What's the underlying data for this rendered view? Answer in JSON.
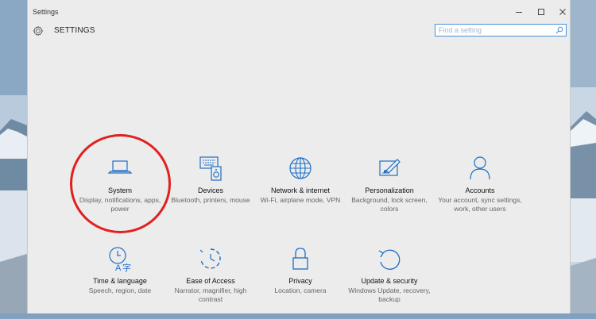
{
  "window": {
    "title": "Settings",
    "minimize_label": "Minimize",
    "maximize_label": "Maximize",
    "close_label": "Close"
  },
  "header": {
    "title": "SETTINGS"
  },
  "search": {
    "placeholder": "Find a setting",
    "value": ""
  },
  "categories": [
    {
      "label": "System",
      "description": "Display, notifications, apps, power",
      "icon": "laptop-icon"
    },
    {
      "label": "Devices",
      "description": "Bluetooth, printers, mouse",
      "icon": "keyboard-speaker-icon"
    },
    {
      "label": "Network & internet",
      "description": "Wi-Fi, airplane mode, VPN",
      "icon": "globe-icon"
    },
    {
      "label": "Personalization",
      "description": "Background, lock screen, colors",
      "icon": "paint-brush-icon"
    },
    {
      "label": "Accounts",
      "description": "Your account, sync settings, work, other users",
      "icon": "person-icon"
    },
    {
      "label": "Time & language",
      "description": "Speech, region, date",
      "icon": "clock-language-icon"
    },
    {
      "label": "Ease of Access",
      "description": "Narrator, magnifier, high contrast",
      "icon": "stopwatch-icon"
    },
    {
      "label": "Privacy",
      "description": "Location, camera",
      "icon": "lock-icon"
    },
    {
      "label": "Update & security",
      "description": "Windows Update, recovery, backup",
      "icon": "refresh-icon"
    }
  ],
  "annotation": {
    "highlight_color": "#e0211f",
    "highlighted_item": "System"
  },
  "colors": {
    "accent": "#1e6fc4",
    "window_bg": "#ececec"
  }
}
